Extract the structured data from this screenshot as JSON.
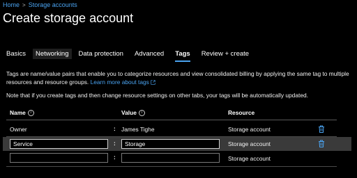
{
  "breadcrumb": {
    "items": [
      "Home",
      "Storage accounts"
    ]
  },
  "page": {
    "title": "Create storage account"
  },
  "tabs": [
    {
      "label": "Basics",
      "active": false
    },
    {
      "label": "Networking",
      "active": false
    },
    {
      "label": "Data protection",
      "active": false
    },
    {
      "label": "Advanced",
      "active": false
    },
    {
      "label": "Tags",
      "active": true
    },
    {
      "label": "Review + create",
      "active": false
    }
  ],
  "description": {
    "text": "Tags are name/value pairs that enable you to categorize resources and view consolidated billing by applying the same tag to multiple resources and resource groups.",
    "link": "Learn more about tags"
  },
  "note": "Note that if you create tags and then change resource settings on other tabs, your tags will be automatically updated.",
  "table": {
    "headers": {
      "name": "Name",
      "value": "Value",
      "resource": "Resource"
    },
    "rows": [
      {
        "name": "Owner",
        "value": "James Tighe",
        "resource": "Storage account",
        "editable": false
      },
      {
        "name": "Service",
        "value": "Storage",
        "resource": "Storage account",
        "editable": true,
        "selected": true
      },
      {
        "name": "",
        "value": "",
        "resource": "Storage account",
        "editable": true,
        "empty": true
      }
    ]
  },
  "colors": {
    "accent": "#4aa3f0",
    "background": "#000000",
    "selected_row": "#3a3a3a"
  },
  "icons": {
    "info": "info-icon",
    "delete": "trash-icon",
    "external_link": "external-link-icon",
    "breadcrumb_separator": "chevron-right-icon"
  }
}
